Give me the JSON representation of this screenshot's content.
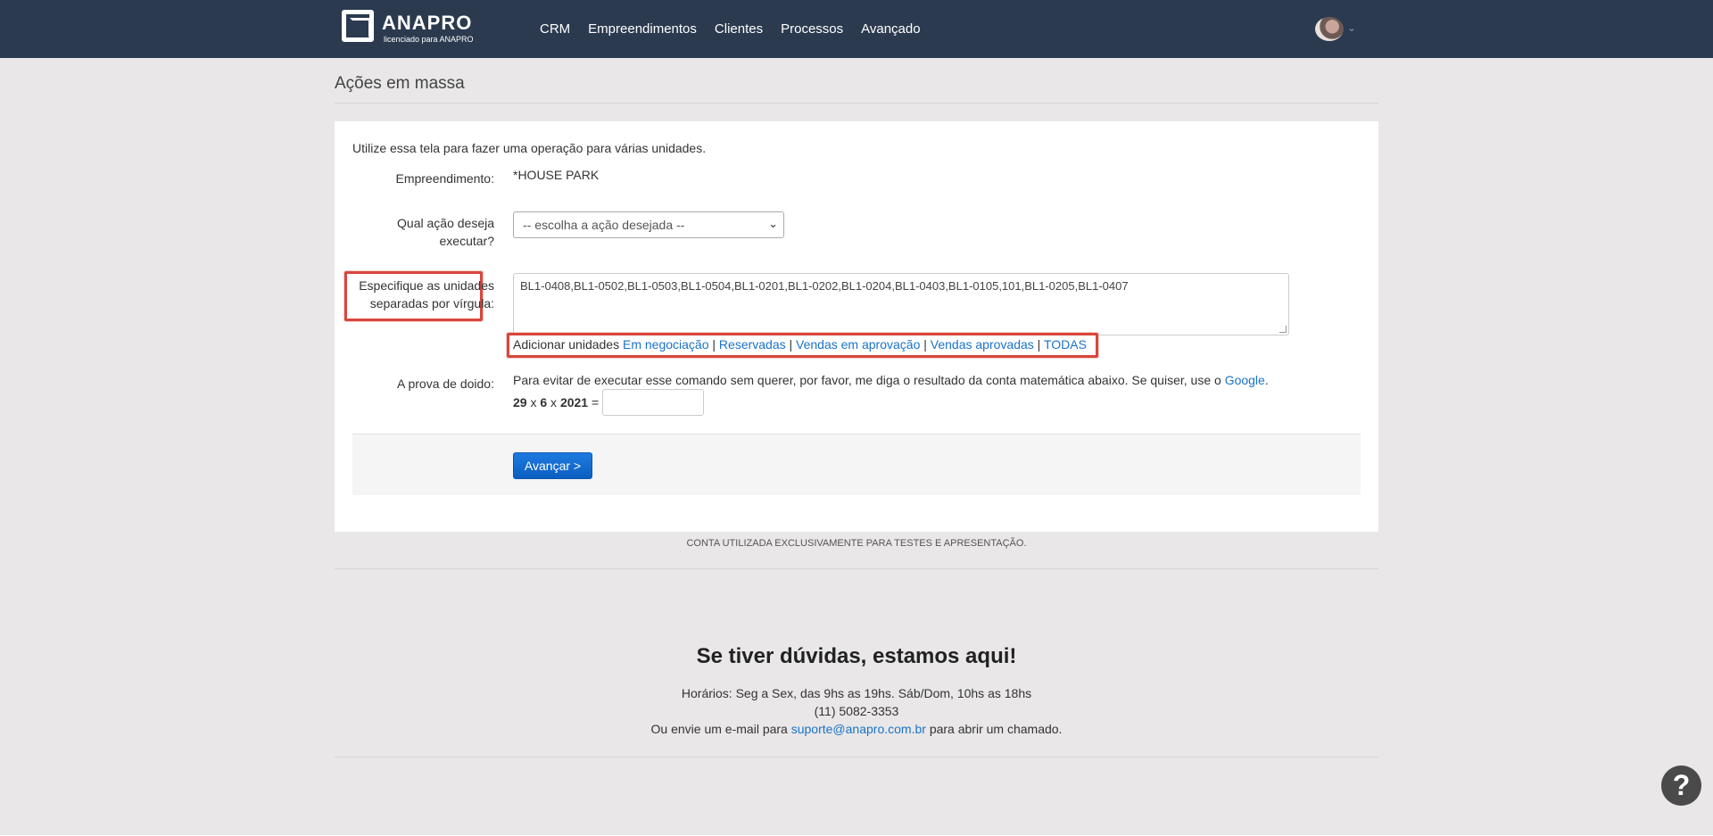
{
  "brand": {
    "name": "ANAPRO",
    "subtitle": "licenciado para ANAPRO"
  },
  "nav": {
    "items": [
      "CRM",
      "Empreendimentos",
      "Clientes",
      "Processos",
      "Avançado"
    ]
  },
  "page": {
    "title": "Ações em massa"
  },
  "form": {
    "intro": "Utilize essa tela para fazer uma operação para várias unidades.",
    "empreendimento_label": "Empreendimento:",
    "empreendimento_value": "*HOUSE PARK",
    "acao_label_line1": "Qual ação deseja",
    "acao_label_line2": "executar?",
    "acao_selected": "-- escolha a ação desejada --",
    "unidades_label_line1": "Especifique as unidades",
    "unidades_label_line2": "separadas por vírgula:",
    "unidades_value": "BL1-0408,BL1-0502,BL1-0503,BL1-0504,BL1-0201,BL1-0202,BL1-0204,BL1-0403,BL1-0105,101,BL1-0205,BL1-0407",
    "add_units_label": "Adicionar unidades",
    "add_links": [
      "Em negociação",
      "Reservadas",
      "Vendas em aprovação",
      "Vendas aprovadas",
      "TODAS"
    ],
    "separator": "|",
    "prova_label": "A prova de doido:",
    "prova_text": "Para evitar de executar esse comando sem querer, por favor, me diga o resultado da conta matemática abaixo. Se quiser, use o",
    "prova_link": "Google",
    "prova_dot": ".",
    "equation": {
      "a": "29",
      "op1": "x",
      "b": "6",
      "op2": "x",
      "c": "2021",
      "eq": "="
    },
    "submit_label": "Avançar >"
  },
  "footer": {
    "disclaimer": "CONTA UTILIZADA EXCLUSIVAMENTE PARA TESTES E APRESENTAÇÃO.",
    "help_title": "Se tiver dúvidas, estamos aqui!",
    "hours": "Horários: Seg a Sex, das 9hs as 19hs. Sáb/Dom, 10hs as 18hs",
    "phone": "(11) 5082-3353",
    "email_prefix": "Ou envie um e-mail para",
    "email": "suporte@anapro.com.br",
    "email_suffix": "para abrir um chamado."
  },
  "help_button": "?",
  "colors": {
    "topbar": "#2b3a4f",
    "link": "#1a73c8",
    "highlight": "#d9463c",
    "button": "#0b5fc0"
  }
}
